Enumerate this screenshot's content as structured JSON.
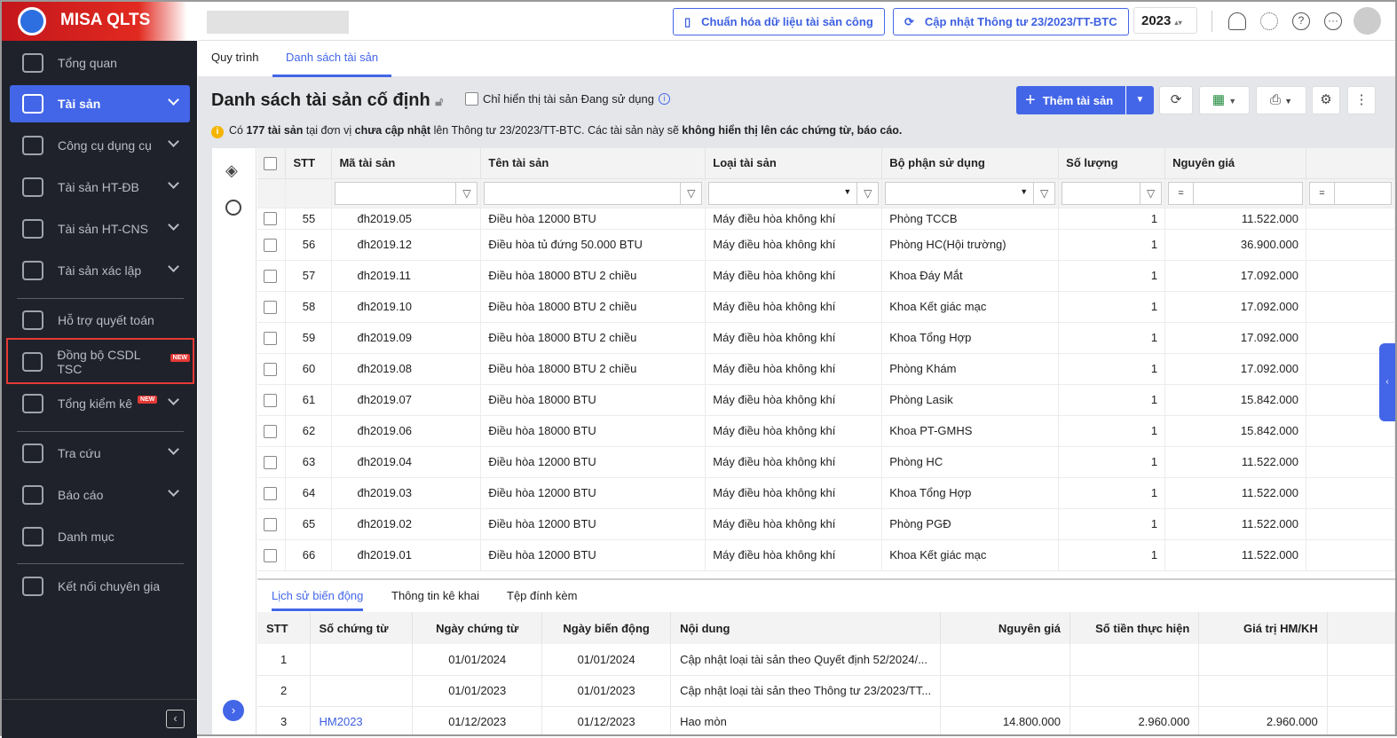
{
  "app": {
    "logo": "MISA QLTS",
    "year": "2023"
  },
  "sidebar": {
    "items": [
      {
        "label": "Tổng quan",
        "chev": false
      },
      {
        "label": "Tài sản",
        "chev": true,
        "active": true
      },
      {
        "label": "Công cụ dụng cụ",
        "chev": true
      },
      {
        "label": "Tài sản HT-ĐB",
        "chev": true
      },
      {
        "label": "Tài sản HT-CNS",
        "chev": true
      },
      {
        "label": "Tài sản xác lập",
        "chev": true
      },
      {
        "label": "Hỗ trợ quyết toán"
      },
      {
        "label": "Đồng bộ CSDL TSC",
        "badge": "NEW"
      },
      {
        "label": "Tổng kiểm kê",
        "badge": "NEW",
        "chev": true
      },
      {
        "label": "Tra cứu",
        "chev": true
      },
      {
        "label": "Báo cáo",
        "chev": true
      },
      {
        "label": "Danh mục"
      },
      {
        "label": "Kết nối chuyên gia"
      }
    ]
  },
  "topbar": {
    "standardize": "Chuẩn hóa dữ liệu tài sản công",
    "update": "Cập nhật Thông tư 23/2023/TT-BTC"
  },
  "tabs": [
    "Quy trình",
    "Danh sách tài sản"
  ],
  "page": {
    "title": "Danh sách tài sản cố định",
    "only_in_use": "Chỉ hiển thị tài sản Đang sử dụng",
    "add": "Thêm tài sản",
    "notice": {
      "p1": "Có ",
      "count": "177 tài sản",
      "p2": " tại đơn vị ",
      "bold1": "chưa cập nhật",
      "p3": " lên Thông tư 23/2023/TT-BTC. Các tài sản này sẽ ",
      "bold2": "không hiển thị lên các chứng từ, báo cáo."
    }
  },
  "grid": {
    "columns": [
      "STT",
      "Mã tài sản",
      "Tên tài sản",
      "Loại tài sản",
      "Bộ phận sử dụng",
      "Số lượng",
      "Nguyên giá"
    ],
    "eq": "=",
    "rows": [
      [
        "55",
        "đh2019.05",
        "Điều hòa 12000 BTU",
        "Máy điều hòa không khí",
        "Phòng TCCB",
        "1",
        "11.522.000"
      ],
      [
        "56",
        "đh2019.12",
        "Điều hòa tủ đứng 50.000 BTU",
        "Máy điều hòa không khí",
        "Phòng HC(Hội trường)",
        "1",
        "36.900.000"
      ],
      [
        "57",
        "đh2019.11",
        "Điều hòa 18000 BTU 2 chiều",
        "Máy điều hòa không khí",
        "Khoa Đáy Mắt",
        "1",
        "17.092.000"
      ],
      [
        "58",
        "đh2019.10",
        "Điều hòa 18000 BTU 2 chiều",
        "Máy điều hòa không khí",
        "Khoa Kết giác mạc",
        "1",
        "17.092.000"
      ],
      [
        "59",
        "đh2019.09",
        "Điều hòa 18000 BTU 2 chiều",
        "Máy điều hòa không khí",
        "Khoa Tổng Hợp",
        "1",
        "17.092.000"
      ],
      [
        "60",
        "đh2019.08",
        "Điều hòa 18000 BTU 2 chiều",
        "Máy điều hòa không khí",
        "Phòng Khám",
        "1",
        "17.092.000"
      ],
      [
        "61",
        "đh2019.07",
        "Điều hòa 18000 BTU",
        "Máy điều hòa không khí",
        "Phòng Lasik",
        "1",
        "15.842.000"
      ],
      [
        "62",
        "đh2019.06",
        "Điều hòa 18000 BTU",
        "Máy điều hòa không khí",
        "Khoa PT-GMHS",
        "1",
        "15.842.000"
      ],
      [
        "63",
        "đh2019.04",
        "Điều hòa 12000 BTU",
        "Máy điều hòa không khí",
        "Phòng HC",
        "1",
        "11.522.000"
      ],
      [
        "64",
        "đh2019.03",
        "Điều hòa 12000 BTU",
        "Máy điều hòa không khí",
        "Khoa Tổng Hợp",
        "1",
        "11.522.000"
      ],
      [
        "65",
        "đh2019.02",
        "Điều hòa 12000 BTU",
        "Máy điều hòa không khí",
        "Phòng PGĐ",
        "1",
        "11.522.000"
      ],
      [
        "66",
        "đh2019.01",
        "Điều hòa 12000 BTU",
        "Máy điều hòa không khí",
        "Khoa Kết giác mạc",
        "1",
        "11.522.000"
      ]
    ]
  },
  "detail": {
    "tabs": [
      "Lịch sử biến động",
      "Thông tin kê khai",
      "Tệp đính kèm"
    ],
    "columns": [
      "STT",
      "Số chứng từ",
      "Ngày chứng từ",
      "Ngày biến động",
      "Nội dung",
      "Nguyên giá",
      "Số tiền thực hiện",
      "Giá trị HM/KH"
    ],
    "rows": [
      [
        "1",
        "",
        "01/01/2024",
        "01/01/2024",
        "Cập nhật loại tài sản theo Quyết định 52/2024/...",
        "",
        "",
        ""
      ],
      [
        "2",
        "",
        "01/01/2023",
        "01/01/2023",
        "Cập nhật loại tài sản theo Thông tư 23/2023/TT...",
        "",
        "",
        ""
      ],
      [
        "3",
        "HM2023",
        "01/12/2023",
        "01/12/2023",
        "Hao mòn",
        "14.800.000",
        "2.960.000",
        "2.960.000"
      ]
    ]
  }
}
